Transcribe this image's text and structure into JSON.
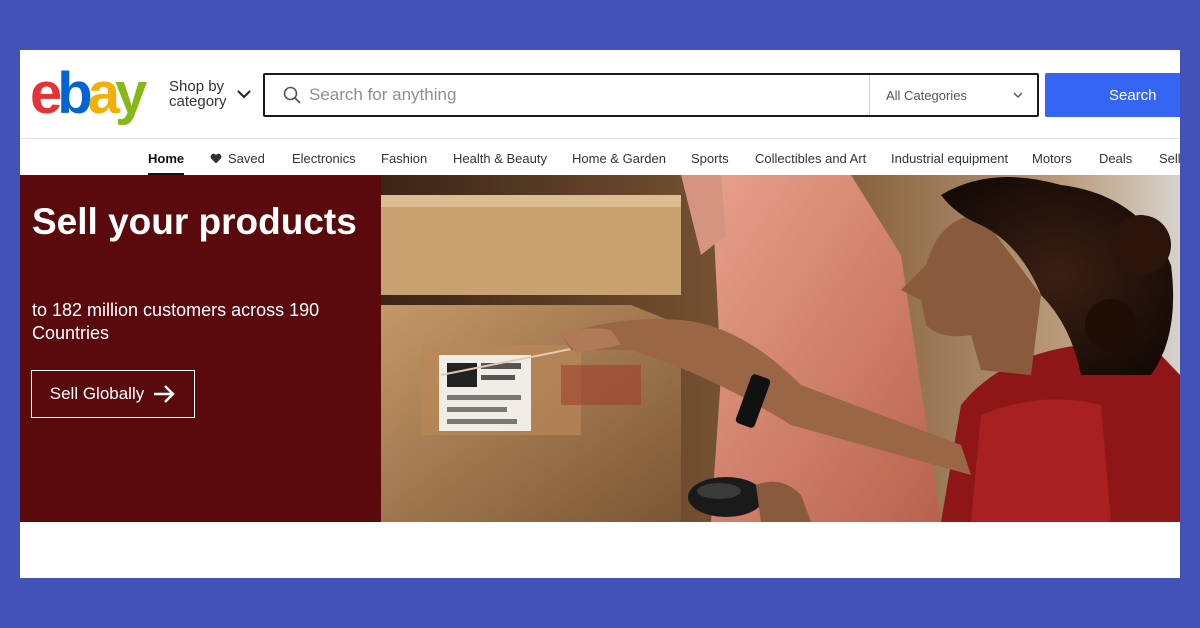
{
  "colors": {
    "background": "#4352b8",
    "search_button": "#3665f3",
    "hero_panel": "#5a0a0c",
    "logo_e": "#e53238",
    "logo_b": "#0064d2",
    "logo_a": "#f5af02",
    "logo_y": "#86b817"
  },
  "header": {
    "logo": {
      "letters": [
        "e",
        "b",
        "a",
        "y"
      ]
    },
    "shop_by_category": "Shop by category",
    "search": {
      "placeholder": "Search for anything",
      "value": "",
      "category": "All Categories",
      "button_label": "Search"
    }
  },
  "nav": {
    "items": [
      {
        "label": "Home",
        "active": true
      },
      {
        "label": "Saved",
        "icon": "heart-icon"
      },
      {
        "label": "Electronics"
      },
      {
        "label": "Fashion"
      },
      {
        "label": "Health & Beauty"
      },
      {
        "label": "Home & Garden"
      },
      {
        "label": "Sports"
      },
      {
        "label": "Collectibles and Art"
      },
      {
        "label": "Industrial equipment"
      },
      {
        "label": "Motors"
      },
      {
        "label": "Deals"
      },
      {
        "label": "Sell"
      }
    ]
  },
  "hero": {
    "title": "Sell your products",
    "subtitle": "to 182 million customers across 190 Countries",
    "button_label": "Sell Globally",
    "button_icon": "arrow-right-icon"
  }
}
